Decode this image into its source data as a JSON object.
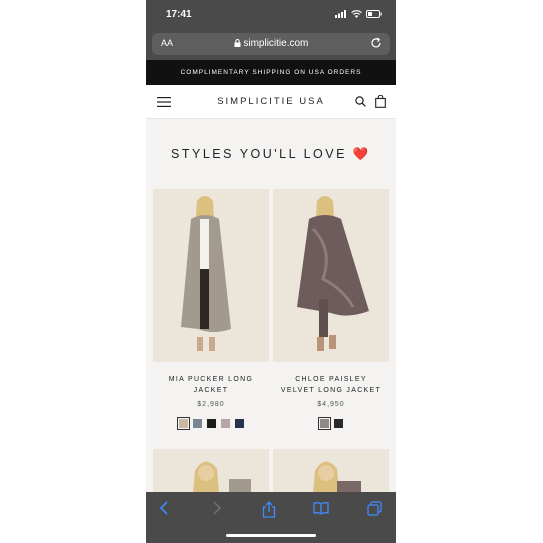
{
  "status": {
    "time": "17:41"
  },
  "browser": {
    "aa_label": "AA",
    "url": "simplicitie.com"
  },
  "promo": {
    "text": "COMPLIMENTARY SHIPPING ON USA ORDERS"
  },
  "header": {
    "logo": "SIMPLICITIE USA"
  },
  "section": {
    "title": "STYLES YOU'LL LOVE ❤️"
  },
  "products": [
    {
      "name": "MIA PUCKER LONG JACKET",
      "price": "$2,980",
      "swatches": [
        "#c9b8a4",
        "#7a8593",
        "#1c1c1c",
        "#b7a6a4",
        "#27324d"
      ]
    },
    {
      "name": "CHLOE PAISLEY VELVET LONG JACKET",
      "price": "$4,950",
      "swatches": [
        "#8e8a86",
        "#2a2a2a"
      ]
    }
  ],
  "icons": {
    "menu": "hamburger-menu-icon",
    "search": "search-icon",
    "cart": "shopping-bag-icon",
    "back": "back-arrow-icon",
    "forward": "forward-arrow-icon",
    "share": "share-icon",
    "bookmarks": "bookmarks-icon",
    "tabs": "tabs-icon"
  }
}
